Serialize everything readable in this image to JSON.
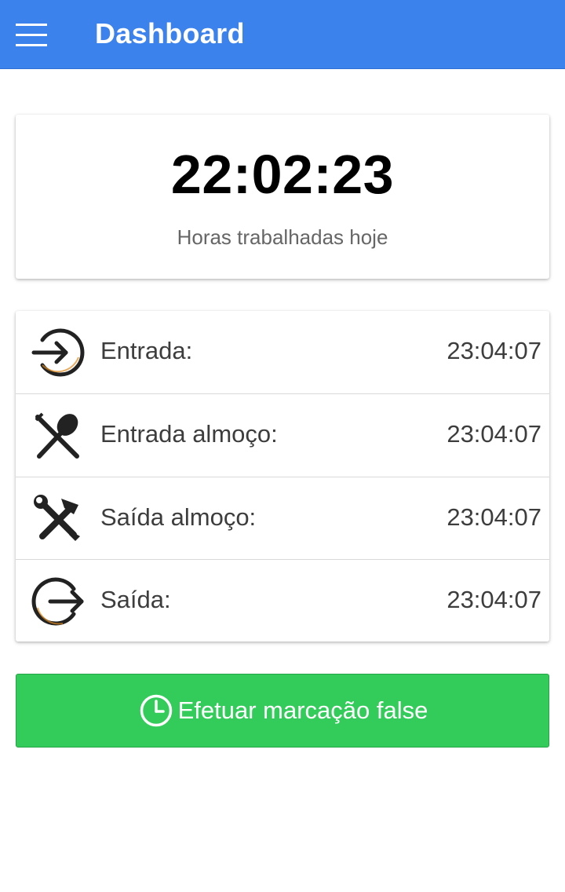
{
  "header": {
    "title": "Dashboard",
    "menu_icon": "hamburger-menu-icon",
    "background_color": "#3b82ed"
  },
  "timer": {
    "value": "22:02:23",
    "caption": "Horas trabalhadas hoje"
  },
  "entries": [
    {
      "icon": "sign-in-icon",
      "label": "Entrada:",
      "time": "23:04:07"
    },
    {
      "icon": "fork-spoon-icon",
      "label": "Entrada almoço:",
      "time": "23:04:07"
    },
    {
      "icon": "tools-icon",
      "label": "Saída almoço:",
      "time": "23:04:07"
    },
    {
      "icon": "sign-out-icon",
      "label": "Saída:",
      "time": "23:04:07"
    }
  ],
  "action_button": {
    "icon": "clock-icon",
    "label": "Efetuar marcação false",
    "color": "#33cc5b"
  },
  "icon_accent_color": "#e08a1e"
}
